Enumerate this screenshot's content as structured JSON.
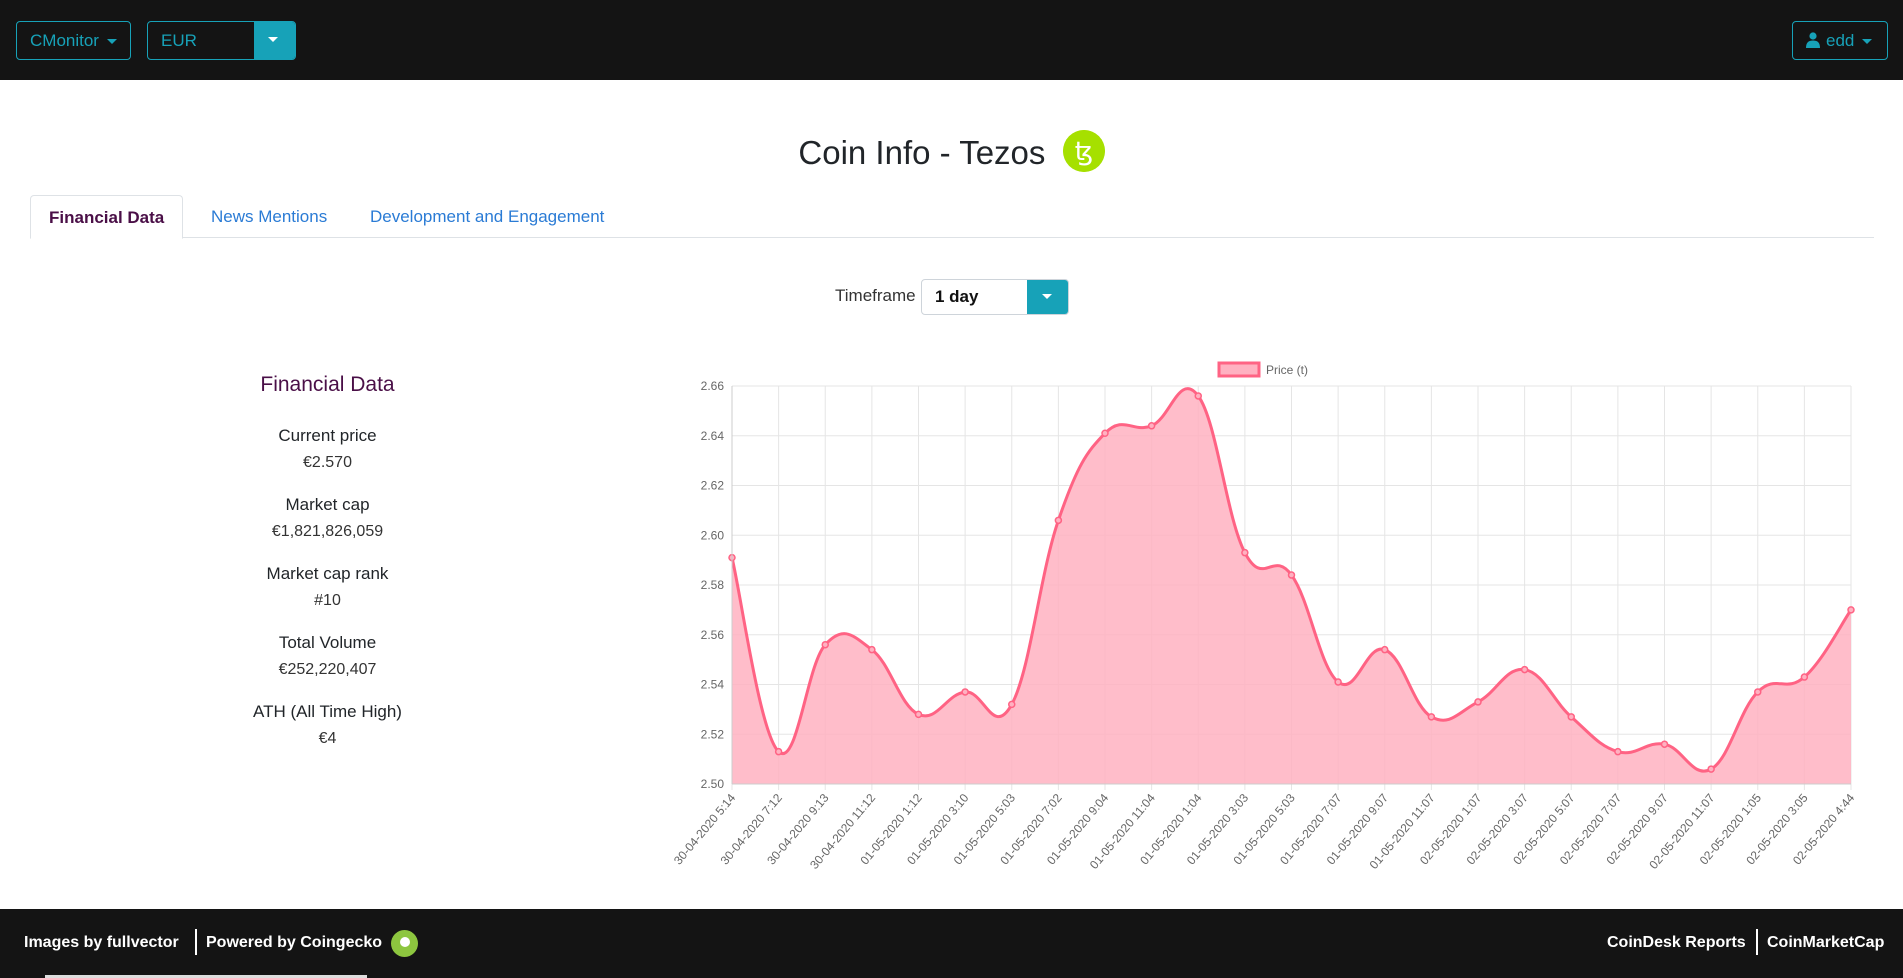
{
  "navbar": {
    "app_button": "CMonitor",
    "currency": "EUR",
    "user": "edd"
  },
  "page": {
    "title": "Coin Info - Tezos",
    "logo_glyph": "ꜩ"
  },
  "tabs": [
    {
      "label": "Financial Data",
      "active": true
    },
    {
      "label": "News Mentions",
      "active": false
    },
    {
      "label": "Development and Engagement",
      "active": false
    }
  ],
  "timeframe": {
    "label": "Timeframe",
    "value": "1 day"
  },
  "financial": {
    "title": "Financial Data",
    "items": [
      {
        "label": "Current price",
        "value": "€2.570"
      },
      {
        "label": "Market cap",
        "value": "€1,821,826,059"
      },
      {
        "label": "Market cap rank",
        "value": "#10"
      },
      {
        "label": "Total Volume",
        "value": "€252,220,407"
      },
      {
        "label": "ATH (All Time High)",
        "value": "€4"
      }
    ]
  },
  "chart_data": {
    "type": "area",
    "legend": "Price (t)",
    "legend_position": "top",
    "grid": true,
    "color": "#ff6384",
    "fill": "#ffb1c1",
    "ylim": [
      2.5,
      2.66
    ],
    "yticks": [
      "2.50",
      "2.52",
      "2.54",
      "2.56",
      "2.58",
      "2.60",
      "2.62",
      "2.64",
      "2.66"
    ],
    "x": [
      "30-04-2020 5:14",
      "30-04-2020 7:12",
      "30-04-2020 9:13",
      "30-04-2020 11:12",
      "01-05-2020 1:12",
      "01-05-2020 3:10",
      "01-05-2020 5:03",
      "01-05-2020 7:02",
      "01-05-2020 9:04",
      "01-05-2020 11:04",
      "01-05-2020 1:04",
      "01-05-2020 3:03",
      "01-05-2020 5:03",
      "01-05-2020 7:07",
      "01-05-2020 9:07",
      "01-05-2020 11:07",
      "02-05-2020 1:07",
      "02-05-2020 3:07",
      "02-05-2020 5:07",
      "02-05-2020 7:07",
      "02-05-2020 9:07",
      "02-05-2020 11:07",
      "02-05-2020 1:05",
      "02-05-2020 3:05",
      "02-05-2020 4:44"
    ],
    "values": [
      2.591,
      2.513,
      2.556,
      2.554,
      2.528,
      2.537,
      2.532,
      2.606,
      2.641,
      2.644,
      2.656,
      2.593,
      2.584,
      2.541,
      2.554,
      2.527,
      2.533,
      2.546,
      2.527,
      2.513,
      2.516,
      2.506,
      2.537,
      2.543,
      2.57
    ]
  },
  "footer": {
    "images_by": "Images by fullvector",
    "powered_by": "Powered by Coingecko",
    "coindesk": "CoinDesk Reports",
    "coinmarketcap": "CoinMarketCap"
  }
}
